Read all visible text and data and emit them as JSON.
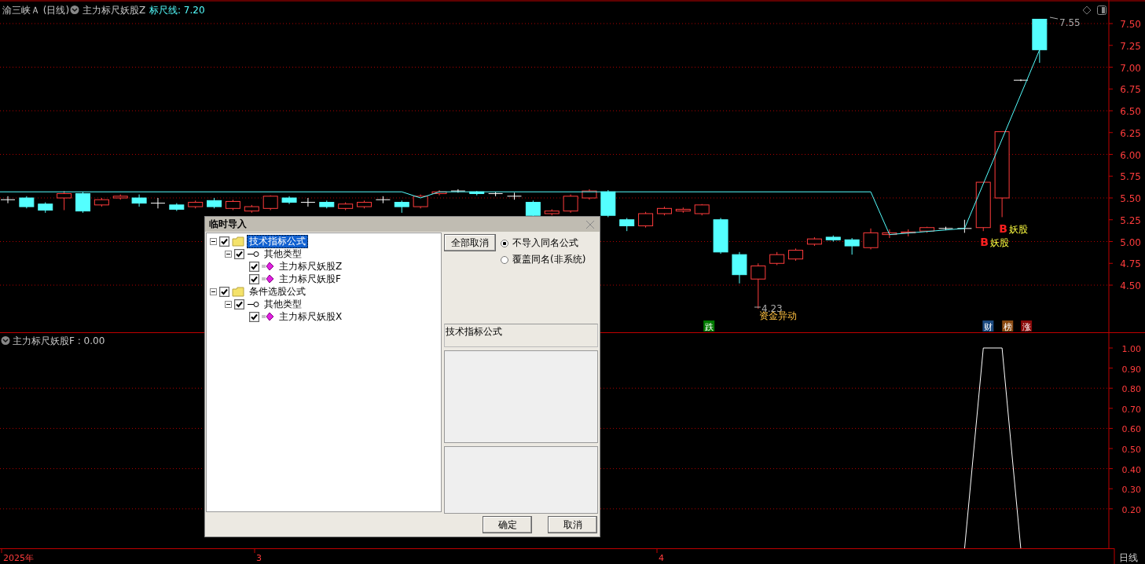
{
  "header": {
    "symbol": "渝三峡Ａ (日线)",
    "indicator": "主力标尺妖股Z",
    "ruler_label": "标尺线: 7.20"
  },
  "price_axis": [
    "7.50",
    "7.25",
    "7.00",
    "6.75",
    "6.50",
    "6.25",
    "6.00",
    "5.75",
    "5.50",
    "5.25",
    "5.00",
    "4.75",
    "4.50"
  ],
  "price_markers": {
    "high": "7.55",
    "low": "4.23"
  },
  "event_label": "资金异动",
  "signals": [
    {
      "letter": "B",
      "text": "妖股"
    },
    {
      "letter": "B",
      "text": "妖股"
    }
  ],
  "badges": [
    {
      "text": "跌",
      "color": "#007a00"
    },
    {
      "text": "财",
      "color": "#1c4a80"
    },
    {
      "text": "榜",
      "color": "#8a4a12"
    },
    {
      "text": "涨",
      "color": "#8a0a0a"
    }
  ],
  "sub_panel": {
    "title": "主力标尺妖股F : 0.00",
    "axis": [
      "1.00",
      "0.90",
      "0.80",
      "0.70",
      "0.60",
      "0.50",
      "0.40",
      "0.30",
      "0.20"
    ]
  },
  "time_axis": [
    "2025年",
    "3",
    "4"
  ],
  "period": "日线",
  "dialog": {
    "title": "临时导入",
    "tree": [
      {
        "label": "技术指标公式",
        "kind": "folder",
        "checked": true,
        "expanded": true,
        "selected": true,
        "children": [
          {
            "label": "其他类型",
            "kind": "group",
            "checked": true,
            "expanded": true,
            "selected": false,
            "children": [
              {
                "label": "主力标尺妖股Z",
                "kind": "formula",
                "checked": true,
                "selected": false
              },
              {
                "label": "主力标尺妖股F",
                "kind": "formula",
                "checked": true,
                "selected": false
              }
            ]
          }
        ]
      },
      {
        "label": "条件选股公式",
        "kind": "folder",
        "checked": true,
        "expanded": true,
        "selected": false,
        "children": [
          {
            "label": "其他类型",
            "kind": "group",
            "checked": true,
            "expanded": true,
            "selected": false,
            "children": [
              {
                "label": "主力标尺妖股X",
                "kind": "formula",
                "checked": true,
                "selected": false
              }
            ]
          }
        ]
      }
    ],
    "clear_all_button": "全部取消",
    "radios": [
      {
        "label": "不导入同名公式",
        "selected": true
      },
      {
        "label": "覆盖同名(非系统)",
        "selected": false
      }
    ],
    "info_label": "技术指标公式",
    "ok_button": "确定",
    "cancel_button": "取消"
  }
}
